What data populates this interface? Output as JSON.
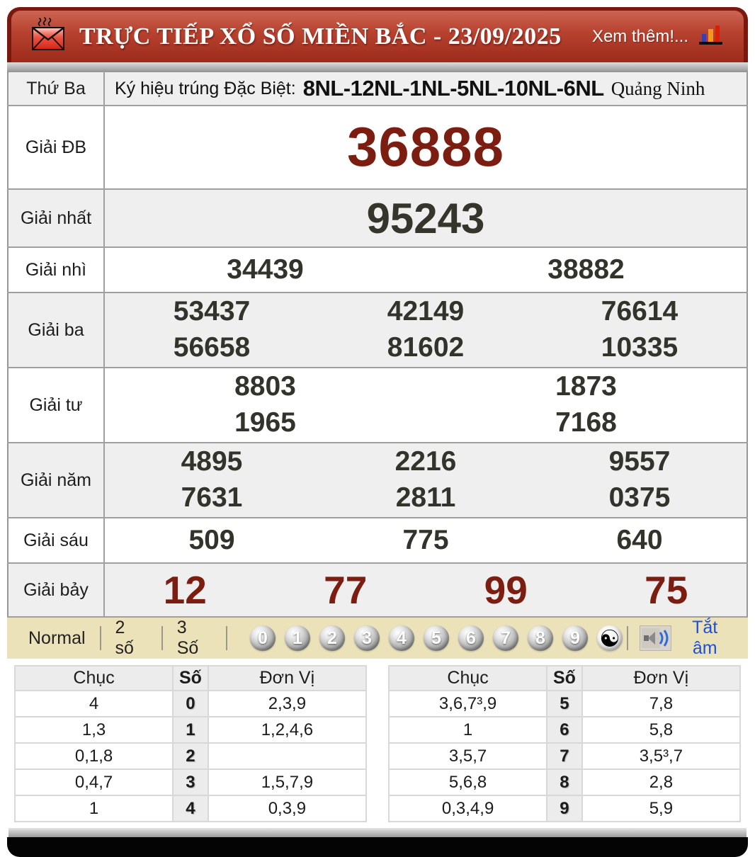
{
  "header": {
    "title": "TRỰC TIẾP XỔ SỐ MIỀN BẮC - 23/09/2025",
    "more_label": "Xem thêm!..."
  },
  "info": {
    "day": "Thứ Ba",
    "label": "Ký hiệu trúng Đặc Biệt:",
    "codes": "8NL-12NL-1NL-5NL-10NL-6NL",
    "province": "Quảng Ninh"
  },
  "prizes": [
    {
      "label": "Giải ĐB",
      "style": "special",
      "cols": 1,
      "numbers": [
        "36888"
      ]
    },
    {
      "label": "Giải nhất",
      "style": "first",
      "cols": 1,
      "numbers": [
        "95243"
      ]
    },
    {
      "label": "Giải nhì",
      "style": "normal",
      "cols": 2,
      "numbers": [
        "34439",
        "38882"
      ]
    },
    {
      "label": "Giải ba",
      "style": "normal",
      "cols": 3,
      "numbers": [
        "53437",
        "42149",
        "76614",
        "56658",
        "81602",
        "10335"
      ]
    },
    {
      "label": "Giải tư",
      "style": "normal",
      "cols": 2,
      "numbers": [
        "8803",
        "1873",
        "1965",
        "7168"
      ]
    },
    {
      "label": "Giải năm",
      "style": "normal",
      "cols": 3,
      "numbers": [
        "4895",
        "2216",
        "9557",
        "7631",
        "2811",
        "0375"
      ]
    },
    {
      "label": "Giải sáu",
      "style": "normal",
      "cols": 3,
      "numbers": [
        "509",
        "775",
        "640"
      ]
    },
    {
      "label": "Giải bảy",
      "style": "red",
      "cols": 4,
      "numbers": [
        "12",
        "77",
        "99",
        "75"
      ]
    }
  ],
  "toolbar": {
    "modes": [
      "Normal",
      "2 số",
      "3 Số"
    ],
    "balls": [
      "0",
      "1",
      "2",
      "3",
      "4",
      "5",
      "6",
      "7",
      "8",
      "9"
    ],
    "yinyang": "☯",
    "mute_label": "Tắt âm"
  },
  "digit_tables": [
    {
      "headers": [
        "Chục",
        "Số",
        "Đơn Vị"
      ],
      "rows": [
        [
          "4",
          "0",
          "2,3,9"
        ],
        [
          "1,3",
          "1",
          "1,2,4,6"
        ],
        [
          "0,1,8",
          "2",
          ""
        ],
        [
          "0,4,7",
          "3",
          "1,5,7,9"
        ],
        [
          "1",
          "4",
          "0,3,9"
        ]
      ]
    },
    {
      "headers": [
        "Chục",
        "Số",
        "Đơn Vị"
      ],
      "rows": [
        [
          "3,6,7³,9",
          "5",
          "7,8"
        ],
        [
          "1",
          "6",
          "5,8"
        ],
        [
          "3,5,7",
          "7",
          "3,5³,7"
        ],
        [
          "5,6,8",
          "8",
          "2,8"
        ],
        [
          "0,3,4,9",
          "9",
          "5,9"
        ]
      ]
    }
  ],
  "colors": {
    "header_red": "#a82c1e",
    "header_maroon": "#7a180e",
    "special_red": "#7c1d12",
    "number_dark": "#32332b",
    "toolbar_beige": "#ece2ba",
    "link_blue": "#1b50d4"
  }
}
